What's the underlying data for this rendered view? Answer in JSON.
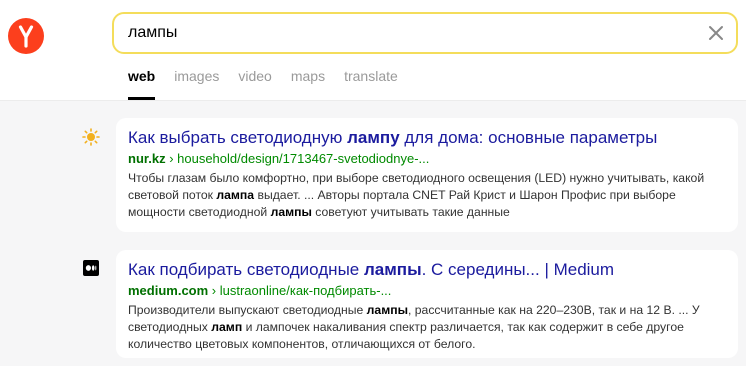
{
  "search": {
    "query": "лампы"
  },
  "tabs": [
    {
      "label": "web",
      "active": true
    },
    {
      "label": "images",
      "active": false
    },
    {
      "label": "video",
      "active": false
    },
    {
      "label": "maps",
      "active": false
    },
    {
      "label": "translate",
      "active": false
    }
  ],
  "colors": {
    "logo": "#fc3f1d",
    "search_border": "#f4dd5b",
    "title_link": "#1b1b9e",
    "url_green": "#008a00",
    "page_bg": "#f6f6f7"
  },
  "results": [
    {
      "favicon": "sun-icon",
      "title": [
        {
          "text": "Как выбрать светодиодную ",
          "bold": false
        },
        {
          "text": "лампу",
          "bold": true
        },
        {
          "text": " для дома: основные параметры",
          "bold": false
        }
      ],
      "host": "nur.kz",
      "separator": " › ",
      "path": "household/design/1713467-svetodiodnye-...",
      "snippet": [
        {
          "text": "Чтобы глазам было комфортно, при выборе светодиодного освещения (LED) нужно учитывать, какой световой поток ",
          "bold": false
        },
        {
          "text": "лампа",
          "bold": true
        },
        {
          "text": " выдает. ... Авторы портала CNET Рай Крист и Шарон Профис при выборе мощности светодиодной ",
          "bold": false
        },
        {
          "text": "лампы",
          "bold": true
        },
        {
          "text": " советуют учитывать такие данные",
          "bold": false
        }
      ]
    },
    {
      "favicon": "medium-icon",
      "title": [
        {
          "text": "Как подбирать светодиодные ",
          "bold": false
        },
        {
          "text": "лампы",
          "bold": true
        },
        {
          "text": ". С середины... | Medium",
          "bold": false
        }
      ],
      "host": "medium.com",
      "separator": " › ",
      "path": "lustraonline/как-подбирать-...",
      "snippet": [
        {
          "text": "Производители выпускают светодиодные ",
          "bold": false
        },
        {
          "text": "лампы",
          "bold": true
        },
        {
          "text": ", рассчитанные как на 220–230В, так и на 12 В. ... У светодиодных ",
          "bold": false
        },
        {
          "text": "ламп",
          "bold": true
        },
        {
          "text": " и лампочек накаливания спектр различается, так как содержит в себе другое количество цветовых компонентов, отличающихся от белого.",
          "bold": false
        }
      ]
    }
  ]
}
